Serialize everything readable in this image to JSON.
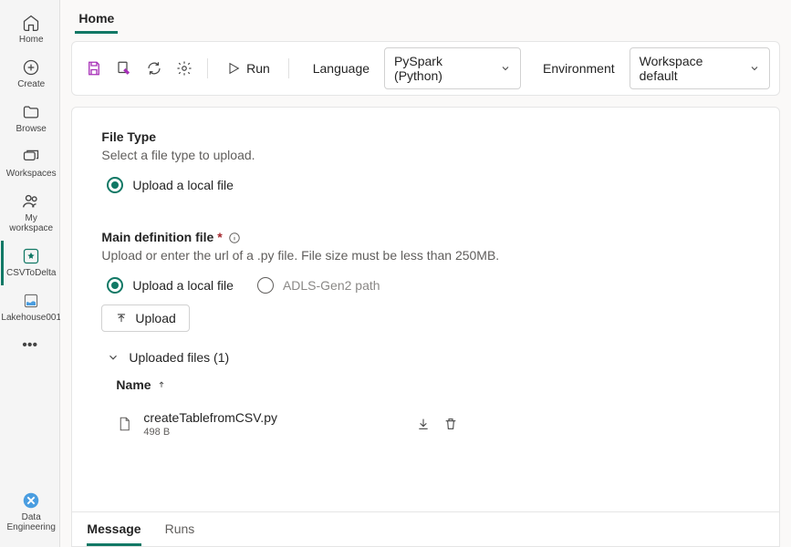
{
  "sidebar": {
    "items": [
      {
        "label": "Home"
      },
      {
        "label": "Create"
      },
      {
        "label": "Browse"
      },
      {
        "label": "Workspaces"
      },
      {
        "label": "My workspace"
      },
      {
        "label": "CSVToDelta"
      },
      {
        "label": "Lakehouse001"
      }
    ],
    "more": "•••",
    "bottom": {
      "label": "Data Engineering"
    }
  },
  "header": {
    "tab": "Home"
  },
  "toolbar": {
    "run": "Run",
    "language_label": "Language",
    "language_value": "PySpark (Python)",
    "env_label": "Environment",
    "env_value": "Workspace default"
  },
  "file_type": {
    "title": "File Type",
    "desc": "Select a file type to upload.",
    "option1": "Upload a local file"
  },
  "main_def": {
    "title": "Main definition file",
    "desc": "Upload or enter the url of a .py file. File size must be less than 250MB.",
    "opt_local": "Upload a local file",
    "opt_adls": "ADLS-Gen2 path",
    "upload_btn": "Upload",
    "uploaded_label": "Uploaded files (1)",
    "col_name": "Name",
    "file": {
      "name": "createTablefromCSV.py",
      "size": "498 B"
    }
  },
  "bottom_tabs": {
    "message": "Message",
    "runs": "Runs"
  }
}
